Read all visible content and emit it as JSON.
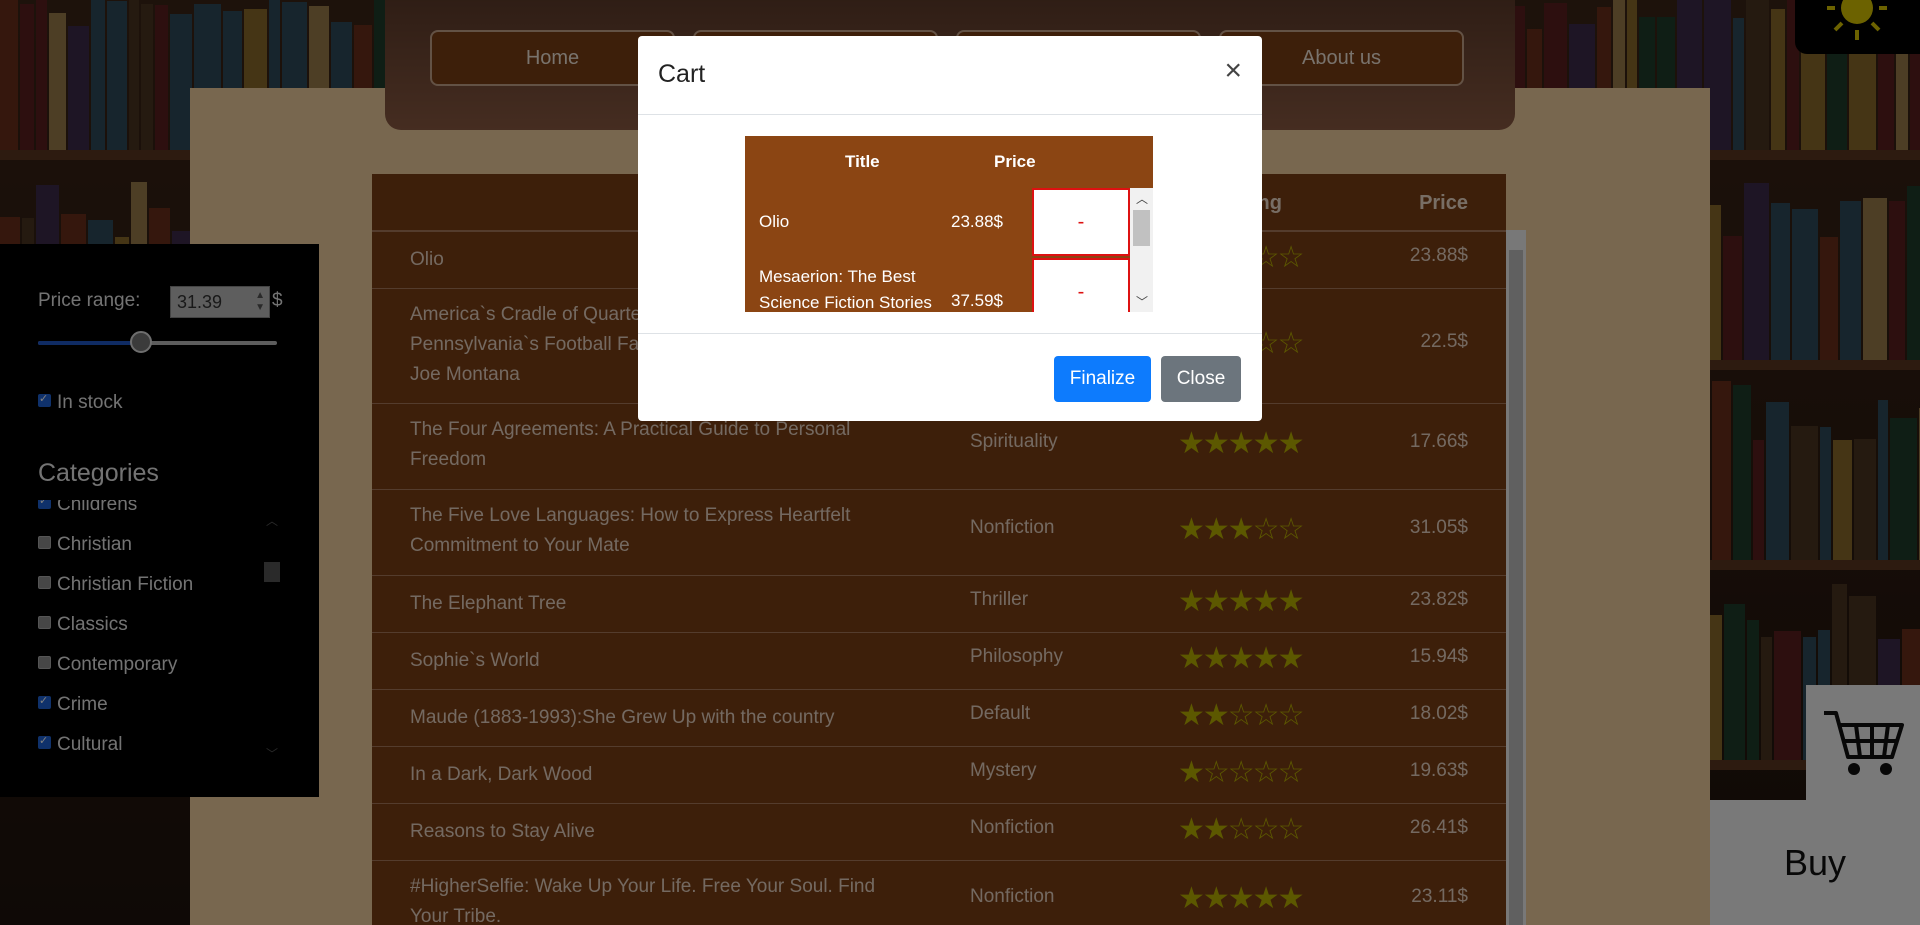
{
  "nav": {
    "items": [
      {
        "label": "Home"
      },
      {
        "label": ""
      },
      {
        "label": ""
      },
      {
        "label": "About us"
      }
    ]
  },
  "theme_icon": "sun-icon",
  "table": {
    "columns": [
      "",
      "",
      "ing",
      "Price"
    ],
    "rows": [
      {
        "title": "Olio",
        "category": "",
        "rating": 3,
        "price": "23.88$"
      },
      {
        "title": "America`s Cradle of Quarterbacks: Western Pennsylvania`s Football Factory from Johnny Unitas to Joe Montana",
        "category": "",
        "rating": 2,
        "price": "22.5$"
      },
      {
        "title": "The Four Agreements: A Practical Guide to Personal Freedom",
        "category": "Spirituality",
        "rating": 5,
        "price": "17.66$"
      },
      {
        "title": "The Five Love Languages: How to Express Heartfelt Commitment to Your Mate",
        "category": "Nonfiction",
        "rating": 3,
        "price": "31.05$"
      },
      {
        "title": "The Elephant Tree",
        "category": "Thriller",
        "rating": 5,
        "price": "23.82$"
      },
      {
        "title": "Sophie`s World",
        "category": "Philosophy",
        "rating": 5,
        "price": "15.94$"
      },
      {
        "title": "Maude (1883-1993):She Grew Up with the country",
        "category": "Default",
        "rating": 2,
        "price": "18.02$"
      },
      {
        "title": "In a Dark, Dark Wood",
        "category": "Mystery",
        "rating": 1,
        "price": "19.63$"
      },
      {
        "title": "Reasons to Stay Alive",
        "category": "Nonfiction",
        "rating": 2,
        "price": "26.41$"
      },
      {
        "title": "#HigherSelfie: Wake Up Your Life. Free Your Soul. Find Your Tribe.",
        "category": "Nonfiction",
        "rating": 5,
        "price": "23.11$"
      }
    ]
  },
  "sidebar": {
    "price_label": "Price range:",
    "price_value": "31.39",
    "currency": "$",
    "slider_fraction": 0.43,
    "in_stock_label": "In stock",
    "in_stock_checked": true,
    "categories_title": "Categories",
    "categories": [
      {
        "label": "Childrens",
        "checked": true
      },
      {
        "label": "Christian",
        "checked": false
      },
      {
        "label": "Christian Fiction",
        "checked": false
      },
      {
        "label": "Classics",
        "checked": false
      },
      {
        "label": "Contemporary",
        "checked": false
      },
      {
        "label": "Crime",
        "checked": true
      },
      {
        "label": "Cultural",
        "checked": true
      }
    ]
  },
  "cart_widget": {
    "icon": "shopping-cart-icon",
    "buy_label": "Buy"
  },
  "modal": {
    "title": "Cart",
    "close_symbol": "×",
    "columns": {
      "title": "Title",
      "price": "Price"
    },
    "items": [
      {
        "title": "Olio",
        "price": "23.88$",
        "remove": "-"
      },
      {
        "title": "Mesaerion: The Best Science Fiction Stories",
        "price": "37.59$",
        "remove": "-"
      }
    ],
    "finalize_label": "Finalize",
    "close_label": "Close"
  },
  "colors": {
    "accent_brown": "#8b4513",
    "primary_blue": "#0d7bfd",
    "secondary_gray": "#6c757d",
    "star_olive": "#b8b000"
  }
}
